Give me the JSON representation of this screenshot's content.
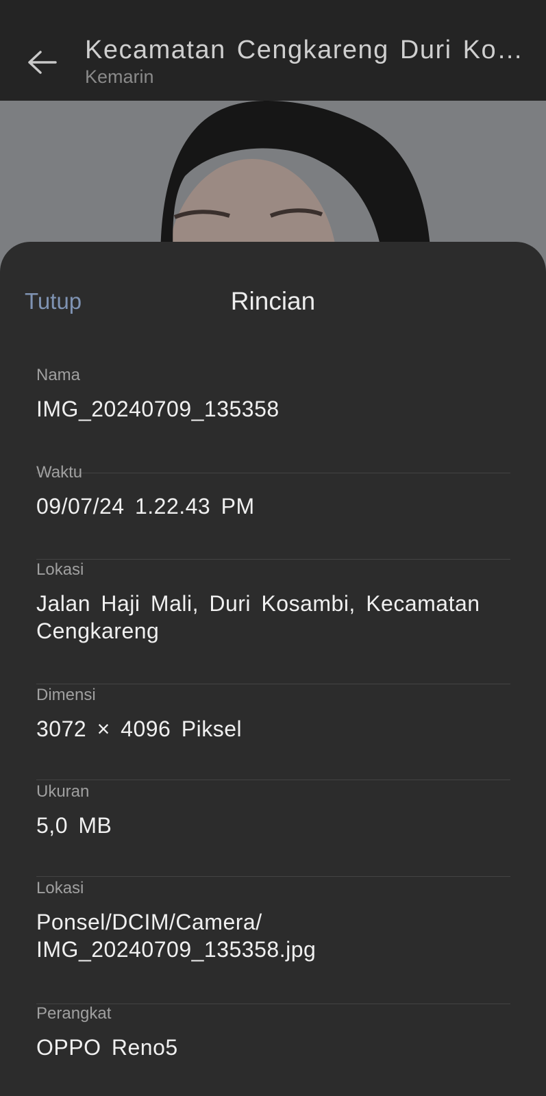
{
  "header": {
    "title": "Kecamatan Cengkareng Duri Kosambi",
    "subtitle": "Kemarin"
  },
  "sheet": {
    "close_label": "Tutup",
    "title": "Rincian",
    "rows": [
      {
        "label": "Nama",
        "value": "IMG_20240709_135358"
      },
      {
        "label": "Waktu",
        "value": "09/07/24 1.22.43 PM"
      },
      {
        "label": "Lokasi",
        "value": "Jalan Haji Mali, Duri Kosambi, Kecamatan Cengkareng"
      },
      {
        "label": "Dimensi",
        "value": "3072 × 4096 Piksel"
      },
      {
        "label": "Ukuran",
        "value": "5,0 MB"
      },
      {
        "label": "Lokasi",
        "value": "Ponsel/DCIM/Camera/ IMG_20240709_135358.jpg"
      },
      {
        "label": "Perangkat",
        "value": "OPPO Reno5"
      }
    ]
  },
  "icons": {
    "back": "arrow-left-icon"
  },
  "colors": {
    "accent_link": "#7f93b3",
    "sheet_bg": "#2c2c2c",
    "topbar_bg": "#242424"
  }
}
